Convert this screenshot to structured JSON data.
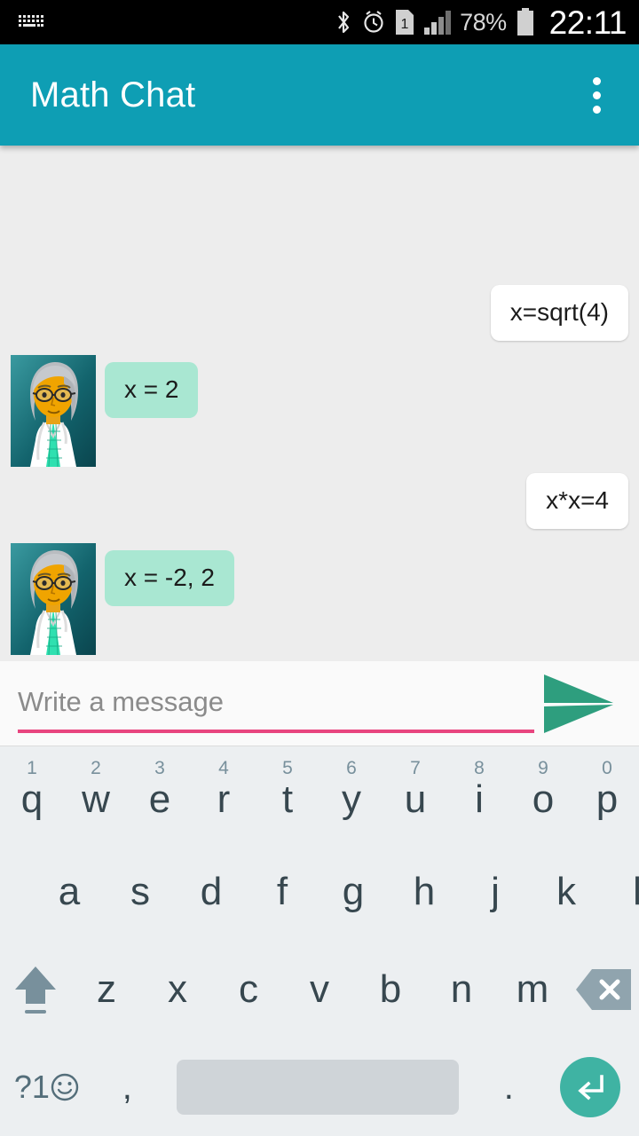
{
  "status_bar": {
    "left_icon": "keyboard-icon",
    "icons": [
      "bluetooth-icon",
      "alarm-icon",
      "sim-1-icon",
      "signal-icon"
    ],
    "sim_label": "1",
    "battery_percent": "78%",
    "time": "22:11"
  },
  "app_bar": {
    "title": "Math Chat",
    "overflow_icon": "overflow-menu-icon",
    "background_color": "#0e9eb4"
  },
  "chat": {
    "background_color": "#ededed",
    "outgoing_bubble_color": "#ffffff",
    "incoming_bubble_color": "#a9e7d2",
    "messages": [
      {
        "sender": "user",
        "text": "x=sqrt(4)"
      },
      {
        "sender": "bot",
        "text": "x = 2",
        "avatar": "professor-avatar"
      },
      {
        "sender": "user",
        "text": "x*x=4"
      },
      {
        "sender": "bot",
        "text": "x = -2, 2",
        "avatar": "professor-avatar"
      }
    ]
  },
  "input_bar": {
    "placeholder": "Write a message",
    "value": "",
    "underline_color": "#e8457f",
    "send_icon": "send-icon",
    "send_icon_color": "#2e9e7e"
  },
  "keyboard": {
    "row1": [
      {
        "key": "q",
        "num": "1"
      },
      {
        "key": "w",
        "num": "2"
      },
      {
        "key": "e",
        "num": "3"
      },
      {
        "key": "r",
        "num": "4"
      },
      {
        "key": "t",
        "num": "5"
      },
      {
        "key": "y",
        "num": "6"
      },
      {
        "key": "u",
        "num": "7"
      },
      {
        "key": "i",
        "num": "8"
      },
      {
        "key": "o",
        "num": "9"
      },
      {
        "key": "p",
        "num": "0"
      }
    ],
    "row2": [
      "a",
      "s",
      "d",
      "f",
      "g",
      "h",
      "j",
      "k",
      "l"
    ],
    "row3": {
      "shift_icon": "shift-icon",
      "keys": [
        "z",
        "x",
        "c",
        "v",
        "b",
        "n",
        "m"
      ],
      "backspace_icon": "backspace-icon"
    },
    "row4": {
      "symbols_label": "?1",
      "emoji_icon": "smiley-icon",
      "comma": ",",
      "space": "",
      "period": ".",
      "enter_icon": "enter-icon",
      "enter_color": "#3fb3a3"
    }
  }
}
